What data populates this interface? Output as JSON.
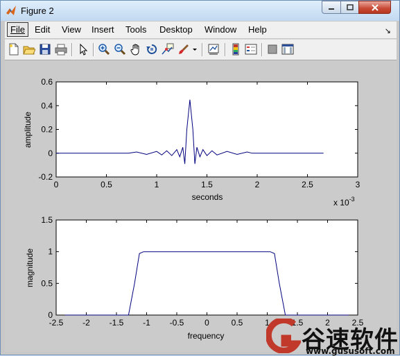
{
  "window": {
    "title": "Figure 2",
    "colors": {
      "accent": "#000080",
      "plot_line": "#00007f"
    }
  },
  "menubar": {
    "items": [
      {
        "label": "File",
        "active": true
      },
      {
        "label": "Edit"
      },
      {
        "label": "View"
      },
      {
        "label": "Insert"
      },
      {
        "label": "Tools"
      },
      {
        "label": "Desktop"
      },
      {
        "label": "Window"
      },
      {
        "label": "Help"
      }
    ]
  },
  "toolbar": {
    "icons": [
      "new-figure-icon",
      "open-file-icon",
      "save-icon",
      "print-icon",
      "edit-plot-arrow-icon",
      "zoom-in-icon",
      "zoom-out-icon",
      "pan-hand-icon",
      "rotate-3d-icon",
      "data-cursor-icon",
      "brush-icon",
      "link-plot-icon",
      "colorbar-icon",
      "legend-icon",
      "hide-plot-tools-icon",
      "show-plot-tools-icon"
    ]
  },
  "chart_data": [
    {
      "type": "line",
      "xlabel": "seconds",
      "ylabel": "amplitude",
      "x_exponent_label": "x 10",
      "x_exponent_power": "-3",
      "xlim": [
        0,
        3
      ],
      "ylim": [
        -0.2,
        0.6
      ],
      "xticks": [
        "0",
        "0.5",
        "1",
        "1.5",
        "2",
        "2.5",
        "3"
      ],
      "yticks": [
        "-0.2",
        "0",
        "0.2",
        "0.4",
        "0.6"
      ],
      "series": [
        {
          "description": "sinc-like pulse centered at ~1.33e-3 s, flat zero from 0 to ~0.72 and ~1.95 to 2.66",
          "x": [
            0,
            0.72,
            0.8,
            0.9,
            1.0,
            1.05,
            1.1,
            1.15,
            1.2,
            1.23,
            1.26,
            1.28,
            1.3,
            1.33,
            1.36,
            1.38,
            1.4,
            1.43,
            1.46,
            1.5,
            1.55,
            1.6,
            1.7,
            1.8,
            1.9,
            1.95,
            2.66
          ],
          "y": [
            0,
            0,
            0.01,
            -0.01,
            0.015,
            -0.015,
            0.02,
            -0.02,
            0.03,
            -0.03,
            0.05,
            -0.09,
            0.2,
            0.45,
            0.2,
            -0.09,
            0.05,
            -0.03,
            0.03,
            -0.02,
            0.02,
            -0.015,
            0.015,
            -0.01,
            0.01,
            0,
            0
          ]
        }
      ]
    },
    {
      "type": "line",
      "xlabel": "frequency",
      "ylabel": "magnitude",
      "xlim": [
        -2.5,
        2.5
      ],
      "ylim": [
        0,
        1.5
      ],
      "xticks": [
        "-2.5",
        "-2",
        "-1.5",
        "-1",
        "-0.5",
        "0",
        "0.5",
        "1",
        "1.5",
        "2",
        "2.5"
      ],
      "yticks": [
        "0",
        "0.5",
        "1",
        "1.5"
      ],
      "series": [
        {
          "description": "band-pass magnitude response, ~1 between -1.1 and 1.1 with small ripple",
          "x": [
            -2.35,
            -1.3,
            -1.2,
            -1.12,
            -1.05,
            0,
            1.05,
            1.12,
            1.2,
            1.3,
            2.35
          ],
          "y": [
            0,
            0,
            0.5,
            0.97,
            1.0,
            1.0,
            1.0,
            0.97,
            0.5,
            0,
            0
          ]
        }
      ]
    }
  ],
  "watermark": {
    "text_cn": "谷速软件",
    "url": "www.gususoft.com"
  }
}
